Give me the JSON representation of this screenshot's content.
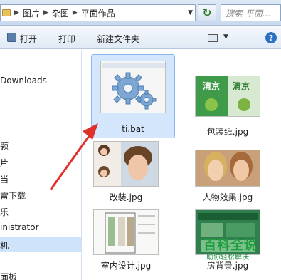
{
  "address": {
    "crumbs": [
      "图片",
      "杂图",
      "平面作品"
    ],
    "separator": "▶",
    "dropdown": "▼",
    "refresh": "↻",
    "search_placeholder": "搜索 平面..."
  },
  "toolbar": {
    "open_label": "打开",
    "print_label": "打印",
    "new_folder_label": "新建文件夹",
    "view_dropdown": "▼",
    "help_label": "?"
  },
  "nav": {
    "items": [
      "Downloads",
      "题",
      "片",
      "当",
      "雷下载",
      "乐",
      "inistrator",
      "机",
      "面板"
    ]
  },
  "files": [
    {
      "name": "ti.bat",
      "icon": "gear-icon",
      "selected": true
    },
    {
      "name": "包装纸.jpg",
      "icon": "image-thumbnail",
      "selected": false
    },
    {
      "name": "改装.jpg",
      "icon": "image-thumbnail",
      "selected": false
    },
    {
      "name": "人物效果.jpg",
      "icon": "image-thumbnail",
      "selected": false
    },
    {
      "name": "室内设计.jpg",
      "icon": "image-thumbnail",
      "selected": false
    },
    {
      "name": "房背景.jpg",
      "icon": "image-thumbnail",
      "selected": false
    }
  ],
  "package_text": "清京",
  "watermark": {
    "title": "百科全说",
    "subtitle": "助你轻松解决"
  },
  "colors": {
    "accent": "#2d6fc4",
    "selection": "#d4e6fb",
    "arrow": "#e0302b",
    "watermark": "#1e9e3c"
  }
}
